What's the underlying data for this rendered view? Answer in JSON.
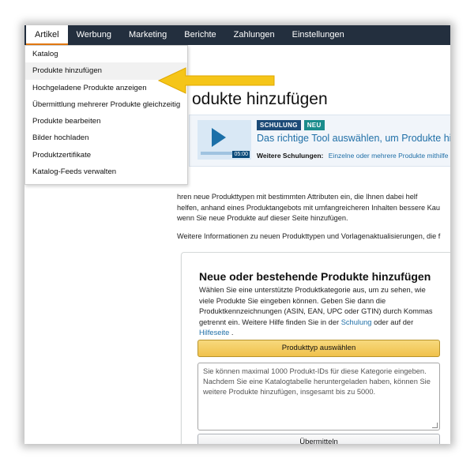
{
  "nav": {
    "tabs": [
      {
        "label": "Artikel"
      },
      {
        "label": "Werbung"
      },
      {
        "label": "Marketing"
      },
      {
        "label": "Berichte"
      },
      {
        "label": "Zahlungen"
      },
      {
        "label": "Einstellungen"
      }
    ]
  },
  "menu": {
    "items": [
      {
        "label": "Katalog"
      },
      {
        "label": "Produkte hinzufügen"
      },
      {
        "label": "Hochgeladene Produkte anzeigen"
      },
      {
        "label": "Übermittlung mehrerer Produkte gleichzeitig"
      },
      {
        "label": "Produkte bearbeiten"
      },
      {
        "label": "Bilder hochladen"
      },
      {
        "label": "Produktzertifikate"
      },
      {
        "label": "Katalog-Feeds verwalten"
      }
    ]
  },
  "page": {
    "title": "odukte hinzufügen"
  },
  "training": {
    "badge_schulung": "SCHULUNG",
    "badge_neu": "NEU",
    "title": "Das richtige Tool auswählen, um Produkte hinz",
    "duration": "05:00",
    "more_label": "Weitere Schulungen:",
    "more_link": "Einzelne oder mehrere Produkte mithilfe d"
  },
  "intro": {
    "line1": "hren neue Produkttypen mit bestimmten Attributen ein, die Ihnen dabei helf",
    "line2": "helfen, anhand eines Produktangebots mit umfangreicheren Inhalten bessere Kau",
    "line3": "wenn Sie neue Produkte auf dieser Seite hinzufügen.",
    "info": "Weitere Informationen zu neuen Produkttypen und Vorlagenaktualisierungen, die f"
  },
  "card": {
    "heading": "Neue oder bestehende Produkte hinzufügen",
    "desc1": "Wählen Sie eine unterstützte Produktkategorie aus, um zu sehen, wie viele Produkte Sie eingeben können. Geben Sie dann die Produktkennzeichnungen (ASIN, EAN, UPC oder GTIN) durch Kommas getrennt ein. Weitere Hilfe finden Sie in der",
    "link_schulung": "Schulung",
    "desc2": "oder auf der",
    "link_hilfeseite": "Hilfeseite",
    "desc3": ".",
    "select_button": "Produkttyp auswählen",
    "textarea_placeholder": "Sie können maximal 1000 Produkt-IDs für diese Kategorie eingeben. Nachdem Sie eine Katalogtabelle heruntergeladen haben, können Sie weitere Produkte hinzufügen, insgesamt bis zu 5000.",
    "submit_button": "Übermitteln"
  },
  "colors": {
    "nav_bg": "#232f3e",
    "accent_yellow": "#f5c518",
    "link": "#1f6fa7",
    "primary_button": "#f0c14b"
  },
  "icons": {
    "pointer_arrow": "yellow-arrow-icon",
    "resize_handle": "resize-handle-icon"
  }
}
